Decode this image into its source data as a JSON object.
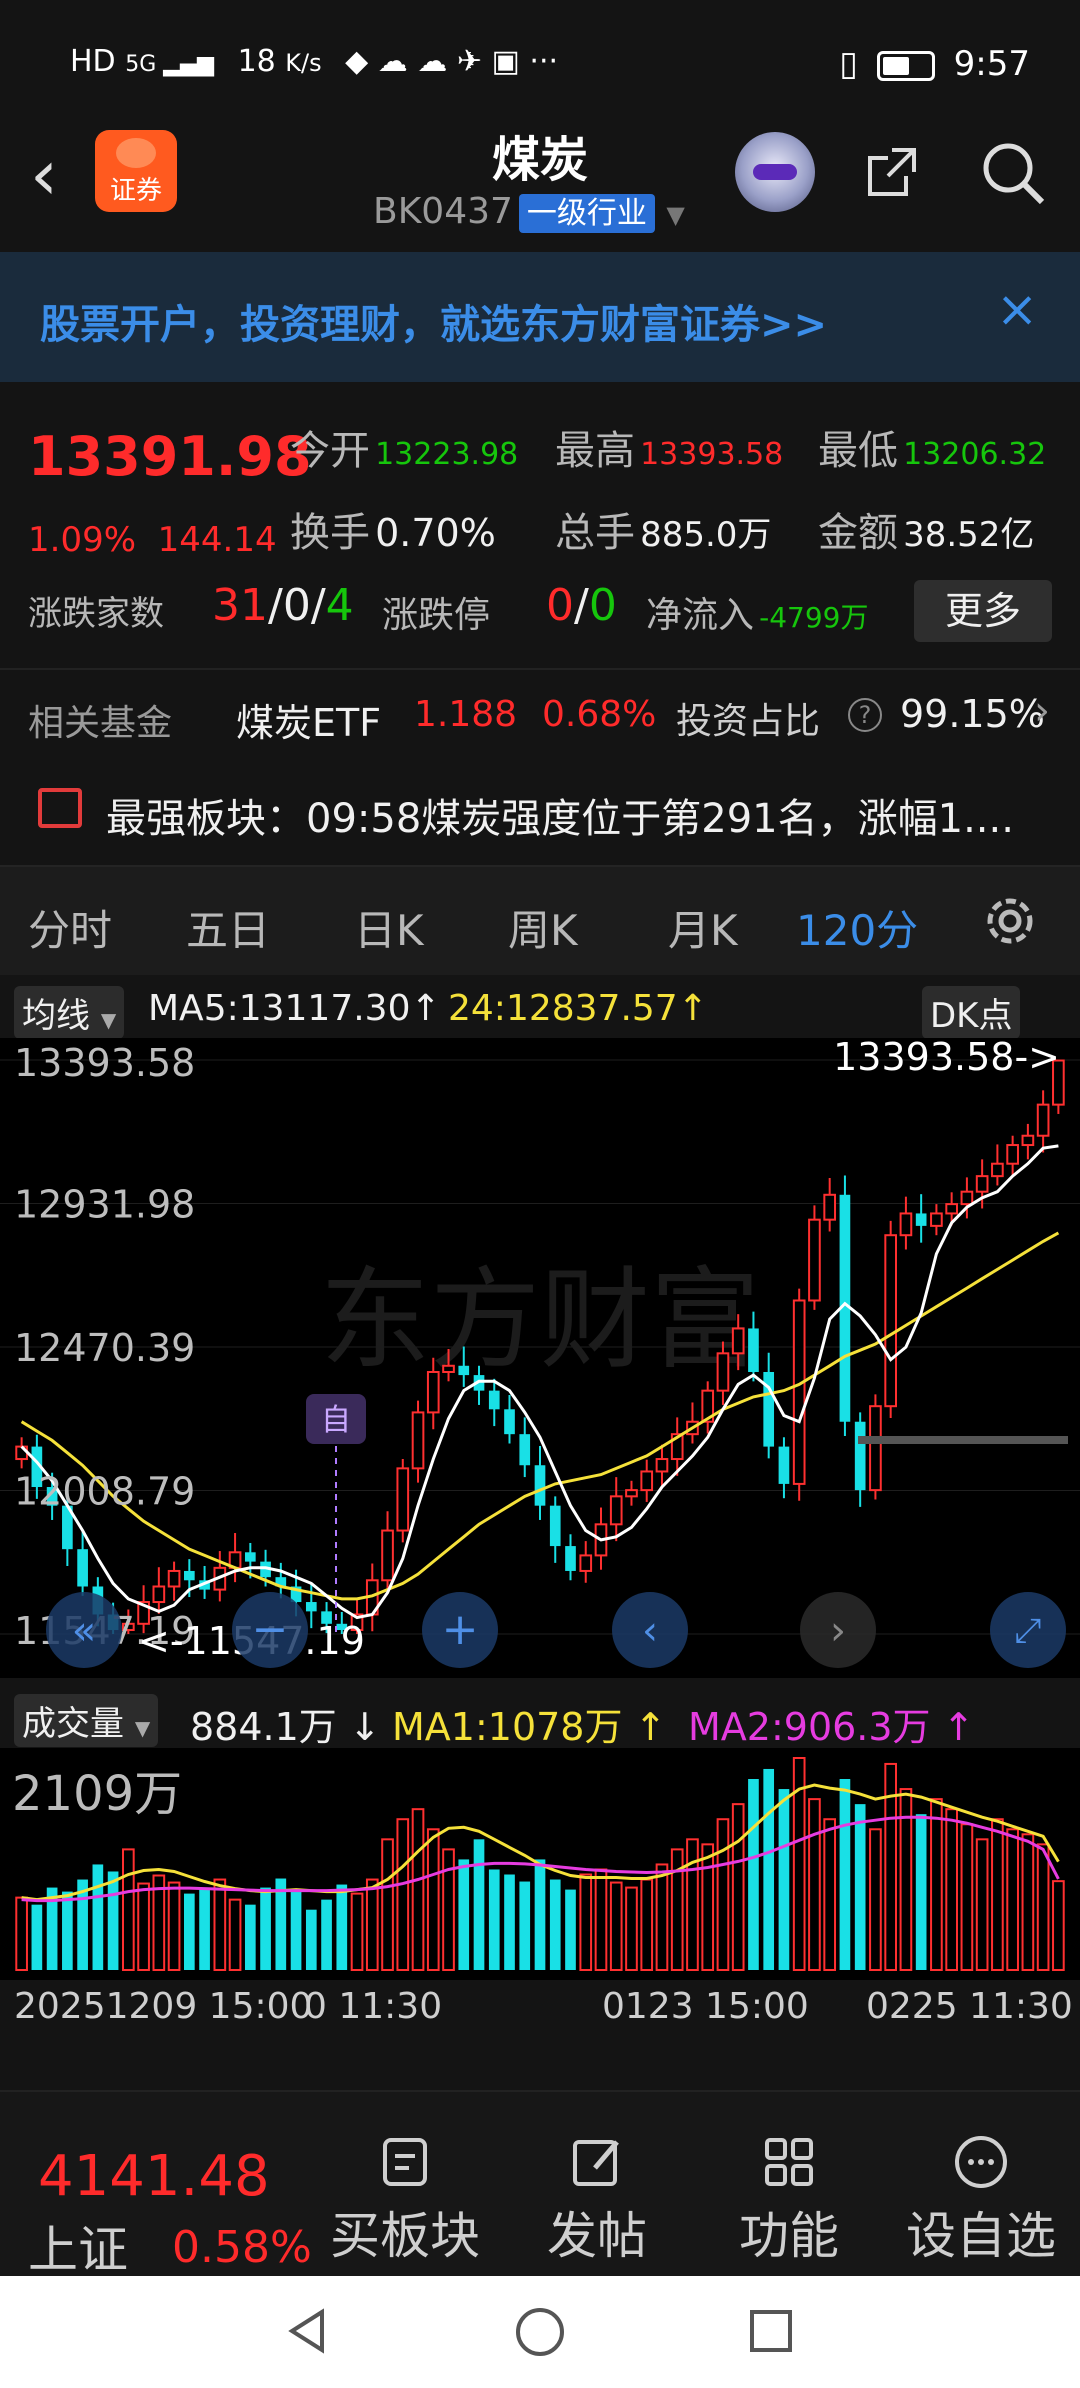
{
  "status": {
    "left_text": "HD 5G ıll 18 K/s ··· ",
    "net_speed": "18",
    "net_unit": "K/s",
    "time": "9:57"
  },
  "header": {
    "back_icon": "back-arrow-icon",
    "app_badge": "证券",
    "title": "煤炭",
    "code": "BK0437",
    "tag": "一级行业"
  },
  "banner": {
    "text": "股票开户，投资理财，就选东方财富证券>>",
    "close": "×"
  },
  "quote": {
    "price": "13391.98",
    "pct": "1.09%",
    "change": "144.14",
    "open_label": "今开",
    "open": "13223.98",
    "high_label": "最高",
    "high": "13393.58",
    "low_label": "最低",
    "low": "13206.32",
    "turnover_label": "换手",
    "turnover": "0.70%",
    "volume_label": "总手",
    "volume": "885.0万",
    "amount_label": "金额",
    "amount": "38.52亿",
    "updown_label": "涨跌家数",
    "up": "31",
    "flat": "0",
    "down": "4",
    "limit_label": "涨跌停",
    "limit_up": "0",
    "limit_down": "0",
    "inflow_label": "净流入",
    "inflow": "-4799万",
    "more": "更多"
  },
  "fund": {
    "label": "相关基金",
    "name": "煤炭ETF",
    "price": "1.188",
    "pct": "0.68%",
    "ratio_label": "投资占比",
    "ratio": "99.15%"
  },
  "strong": {
    "text": "最强板块：09:58煤炭强度位于第291名，涨幅1...."
  },
  "tabs": [
    "分时",
    "五日",
    "日K",
    "周K",
    "月K",
    "120分"
  ],
  "chart_header": {
    "ma_selector": "均线",
    "ma5": "MA5:13117.30",
    "ma24": "24:12837.57",
    "dk": "DK点"
  },
  "chart_data": {
    "type": "candlestick",
    "y_ticks": [
      "13393.58",
      "12931.98",
      "12470.39",
      "12008.79",
      "11547.19"
    ],
    "ylim": [
      11547.19,
      13393.58
    ],
    "high_marker": "13393.58->",
    "low_marker": "<-11547.19",
    "self_marker": "自",
    "x_ticks": [
      "20251209 15:00",
      "0 11:30",
      "0123 15:00",
      "0225 11:30"
    ],
    "closes": [
      12150,
      12020,
      11960,
      11820,
      11700,
      11610,
      11560,
      11580,
      11650,
      11700,
      11750,
      11720,
      11690,
      11760,
      11810,
      11780,
      11730,
      11700,
      11650,
      11620,
      11580,
      11560,
      11610,
      11720,
      11880,
      12080,
      12260,
      12390,
      12410,
      12380,
      12330,
      12270,
      12190,
      12090,
      11960,
      11830,
      11750,
      11800,
      11900,
      11990,
      12010,
      12070,
      12110,
      12190,
      12230,
      12330,
      12450,
      12530,
      12390,
      12150,
      12030,
      12620,
      12880,
      12960,
      12230,
      12010,
      12280,
      12830,
      12900,
      12860,
      12900,
      12930,
      12970,
      13020,
      13060,
      13120,
      13150,
      13250,
      13391.98
    ],
    "ma5": [
      12150,
      12100,
      12040,
      11960,
      11880,
      11790,
      11710,
      11660,
      11640,
      11620,
      11640,
      11690,
      11710,
      11730,
      11750,
      11760,
      11760,
      11750,
      11730,
      11710,
      11670,
      11630,
      11600,
      11610,
      11680,
      11790,
      11960,
      12110,
      12240,
      12330,
      12360,
      12360,
      12330,
      12260,
      12180,
      12070,
      11960,
      11880,
      11850,
      11860,
      11890,
      11950,
      12020,
      12070,
      12120,
      12180,
      12270,
      12350,
      12380,
      12340,
      12250,
      12230,
      12370,
      12560,
      12610,
      12570,
      12510,
      12430,
      12470,
      12580,
      12770,
      12870,
      12920,
      12950,
      12970,
      13020,
      13060,
      13110,
      13117.3
    ],
    "ma24": [
      12230,
      12200,
      12170,
      12130,
      12090,
      12040,
      11990,
      11950,
      11910,
      11880,
      11850,
      11820,
      11800,
      11780,
      11760,
      11740,
      11720,
      11700,
      11690,
      11680,
      11670,
      11660,
      11660,
      11670,
      11690,
      11710,
      11740,
      11780,
      11820,
      11860,
      11900,
      11930,
      11960,
      11990,
      12010,
      12030,
      12040,
      12050,
      12060,
      12080,
      12100,
      12120,
      12150,
      12180,
      12210,
      12240,
      12270,
      12290,
      12310,
      12320,
      12330,
      12350,
      12380,
      12410,
      12440,
      12460,
      12480,
      12510,
      12540,
      12570,
      12600,
      12630,
      12660,
      12690,
      12720,
      12750,
      12780,
      12810,
      12837.57
    ],
    "volume_header": {
      "selector": "成交量",
      "vol": "884.1万",
      "ma1": "MA1:1078万",
      "ma2": "MA2:906.3万",
      "max_label": "2109万"
    },
    "volume": [
      720,
      650,
      820,
      780,
      900,
      1050,
      980,
      1200,
      860,
      940,
      870,
      760,
      800,
      900,
      700,
      650,
      820,
      910,
      780,
      600,
      700,
      850,
      760,
      900,
      1300,
      1500,
      1600,
      1400,
      1200,
      1100,
      1300,
      1000,
      950,
      880,
      1100,
      900,
      800,
      950,
      1000,
      870,
      820,
      900,
      1050,
      1200,
      1300,
      1250,
      1500,
      1650,
      1900,
      2000,
      1800,
      2109,
      1700,
      1500,
      1900,
      1650,
      1400,
      2050,
      1800,
      1550,
      1700,
      1600,
      1450,
      1300,
      1500,
      1400,
      1350,
      1250,
      884
    ],
    "vol_ma1": [
      720,
      700,
      720,
      740,
      780,
      830,
      880,
      950,
      990,
      1000,
      980,
      930,
      880,
      840,
      810,
      790,
      780,
      790,
      800,
      790,
      780,
      780,
      800,
      820,
      900,
      1030,
      1180,
      1320,
      1410,
      1420,
      1380,
      1300,
      1220,
      1140,
      1050,
      990,
      940,
      920,
      920,
      920,
      910,
      910,
      940,
      990,
      1070,
      1120,
      1190,
      1280,
      1420,
      1560,
      1690,
      1800,
      1840,
      1810,
      1790,
      1750,
      1700,
      1730,
      1750,
      1720,
      1670,
      1620,
      1570,
      1520,
      1480,
      1430,
      1380,
      1330,
      1078
    ],
    "vol_ma2": [
      700,
      690,
      690,
      700,
      710,
      730,
      750,
      780,
      800,
      810,
      815,
      815,
      810,
      805,
      800,
      795,
      790,
      790,
      790,
      790,
      790,
      795,
      800,
      810,
      830,
      860,
      900,
      950,
      1000,
      1030,
      1050,
      1060,
      1060,
      1055,
      1045,
      1030,
      1015,
      1000,
      990,
      980,
      975,
      970,
      975,
      985,
      1000,
      1020,
      1050,
      1080,
      1120,
      1170,
      1230,
      1290,
      1350,
      1400,
      1440,
      1470,
      1490,
      1510,
      1520,
      1520,
      1510,
      1490,
      1460,
      1420,
      1380,
      1330,
      1280,
      1200,
      906.3
    ]
  },
  "bottom_nav": {
    "index_value": "4141.48",
    "index_name": "上证",
    "index_pct": "0.58%",
    "items": [
      "买板块",
      "发帖",
      "功能",
      "设自选"
    ]
  }
}
